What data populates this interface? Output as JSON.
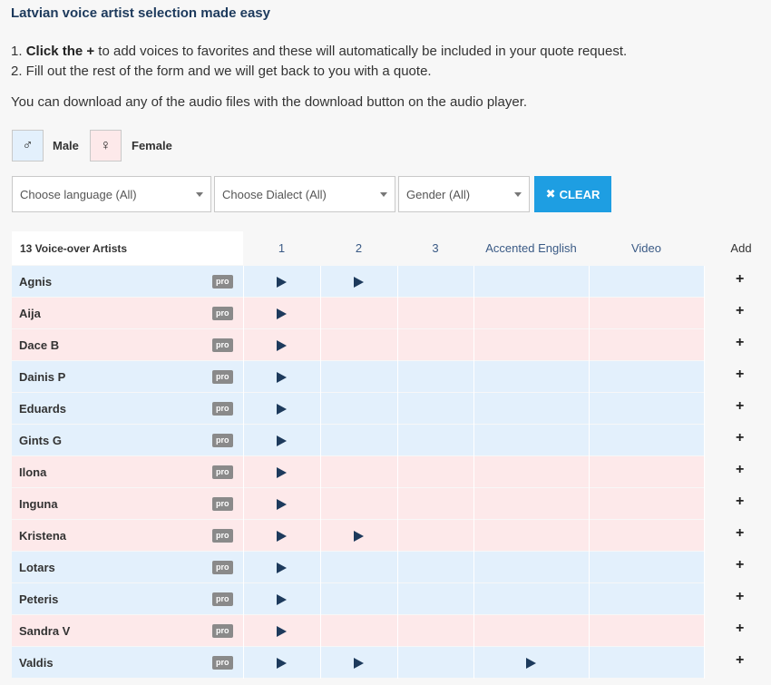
{
  "title": "Latvian voice artist selection made easy",
  "steps": {
    "step1_num": "1.",
    "step1_bold": "Click the +",
    "step1_rest": " to add voices to favorites and these will automatically be included in your quote request.",
    "step2_num": "2.",
    "step2_text": " Fill out the rest of the form and we will get back to you with a quote."
  },
  "download_note": "You can download any of the audio files with the download button on the audio player.",
  "legend": {
    "male_symbol": "♂",
    "male_label": "Male",
    "female_symbol": "♀",
    "female_label": "Female"
  },
  "filters": {
    "language": "Choose language (All)",
    "dialect": "Choose Dialect (All)",
    "gender": "Gender (All)",
    "clear_icon": "✖",
    "clear_label": "CLEAR"
  },
  "colors": {
    "male_row": "#e3f0fc",
    "female_row": "#fde9ea",
    "clear_button": "#1e9ee2",
    "title": "#1d3a5c"
  },
  "table": {
    "count_label": "13 Voice-over Artists",
    "columns": [
      "1",
      "2",
      "3",
      "Accented English",
      "Video",
      "Add"
    ],
    "pro_badge": "pro",
    "add_symbol": "+",
    "rows": [
      {
        "name": "Agnis",
        "gender": "male",
        "samples": [
          true,
          true,
          false,
          false,
          false
        ]
      },
      {
        "name": "Aija",
        "gender": "female",
        "samples": [
          true,
          false,
          false,
          false,
          false
        ]
      },
      {
        "name": "Dace B",
        "gender": "female",
        "samples": [
          true,
          false,
          false,
          false,
          false
        ]
      },
      {
        "name": "Dainis P",
        "gender": "male",
        "samples": [
          true,
          false,
          false,
          false,
          false
        ]
      },
      {
        "name": "Eduards",
        "gender": "male",
        "samples": [
          true,
          false,
          false,
          false,
          false
        ]
      },
      {
        "name": "Gints G",
        "gender": "male",
        "samples": [
          true,
          false,
          false,
          false,
          false
        ]
      },
      {
        "name": "Ilona",
        "gender": "female",
        "samples": [
          true,
          false,
          false,
          false,
          false
        ]
      },
      {
        "name": "Inguna",
        "gender": "female",
        "samples": [
          true,
          false,
          false,
          false,
          false
        ]
      },
      {
        "name": "Kristena",
        "gender": "female",
        "samples": [
          true,
          true,
          false,
          false,
          false
        ]
      },
      {
        "name": "Lotars",
        "gender": "male",
        "samples": [
          true,
          false,
          false,
          false,
          false
        ]
      },
      {
        "name": "Peteris",
        "gender": "male",
        "samples": [
          true,
          false,
          false,
          false,
          false
        ]
      },
      {
        "name": "Sandra V",
        "gender": "female",
        "samples": [
          true,
          false,
          false,
          false,
          false
        ]
      },
      {
        "name": "Valdis",
        "gender": "male",
        "samples": [
          true,
          true,
          false,
          true,
          false
        ]
      }
    ]
  }
}
